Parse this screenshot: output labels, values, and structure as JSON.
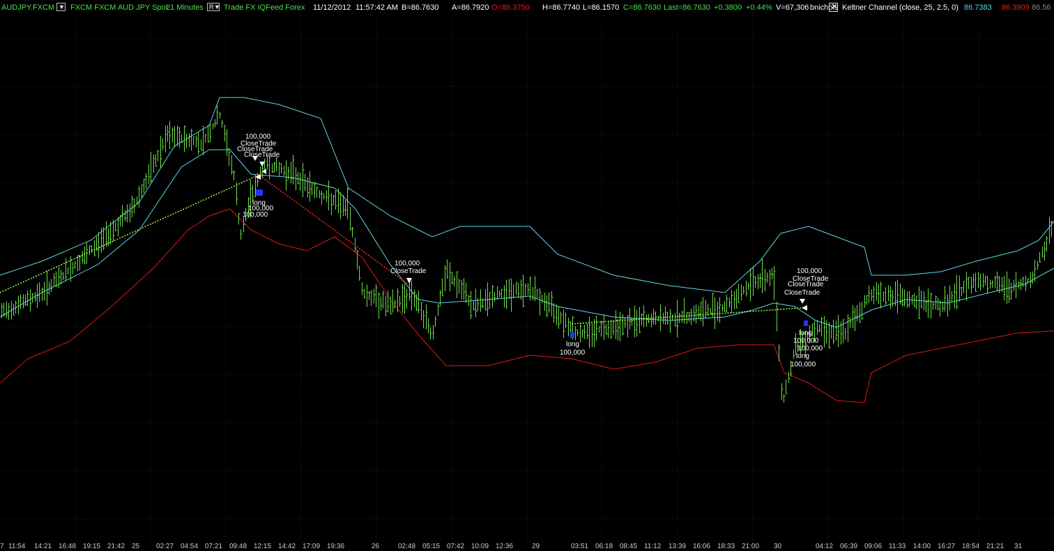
{
  "header": {
    "symbol": "AUDJPY.FXCM",
    "description": "FXCM FXCM AUD JPY Spot",
    "interval": "21 Minutes",
    "symbol_dropdown": "▼",
    "r_button": "R",
    "r_dropdown": "▼",
    "provider": "Trade  FX  IQFeed  Forex",
    "date": "11/12/2012",
    "time": "11:57:42 AM",
    "bid": "B=86.7630",
    "ask": "A=86.7920",
    "open": "O=86.3750",
    "high": "H=86.7740",
    "low": "L=86.1570",
    "close": "C=86.7630",
    "last": "Last=86.7630",
    "change": "+0.3800",
    "change_pct": "+0.44%",
    "volume": "V=67,306",
    "user": "bnichols",
    "indicator_close": "✕",
    "indicator_label": "Keltner Channel  (close,  25,  2.5,  0)",
    "indicator_upper": "86.7383",
    "indicator_lower": "86.3909",
    "indicator_mid": "86.56"
  },
  "colors": {
    "background": "#000000",
    "price_bars": "#6fe04a",
    "keltner_upper": "#5fd8e8",
    "keltner_lower": "#e01818",
    "grid": "#2a2a2a",
    "header_green": "#4be04b",
    "header_red": "#e02020",
    "header_cyan": "#4fd8e8",
    "trade_line_win": "#9cff4a",
    "trade_line_loss": "#ff3030"
  },
  "x_axis_labels": [
    "7",
    "11:54",
    "14:21",
    "16:48",
    "19:15",
    "21:42",
    "25",
    "02:27",
    "04:54",
    "07:21",
    "09:48",
    "12:15",
    "14:42",
    "17:09",
    "19:36",
    "26",
    "02:48",
    "05:15",
    "07:42",
    "10:09",
    "12:36",
    "29",
    "03:51",
    "06:18",
    "08:45",
    "11:12",
    "13:39",
    "16:06",
    "18:33",
    "21:00",
    "30",
    "04:12",
    "06:39",
    "09:06",
    "11:33",
    "14:00",
    "16:27",
    "18:54",
    "21:21",
    "31"
  ],
  "trade_labels": {
    "t1_qty": "100,000",
    "t1_close_a": "CloseTrade",
    "t1_close_b": "CloseTrade",
    "t1_close_c": "CloseTrade",
    "t1_long": "long",
    "t1_qty_b": "100,000",
    "t1_qty_c": "100,000",
    "t2_qty": "100,000",
    "t2_close": "CloseTrade",
    "t3_long": "long",
    "t3_qty": "100,000",
    "t4_qty": "100,000",
    "t4_close_a": "CloseTrade",
    "t4_close_b": "CloseTrade",
    "t4_close_c": "CloseTrade",
    "t4_long_a": "long",
    "t4_qty_b": "100,000",
    "t4_qty_c": "100,000",
    "t4_long_b": "long",
    "t4_qty_d": "100,000"
  }
}
